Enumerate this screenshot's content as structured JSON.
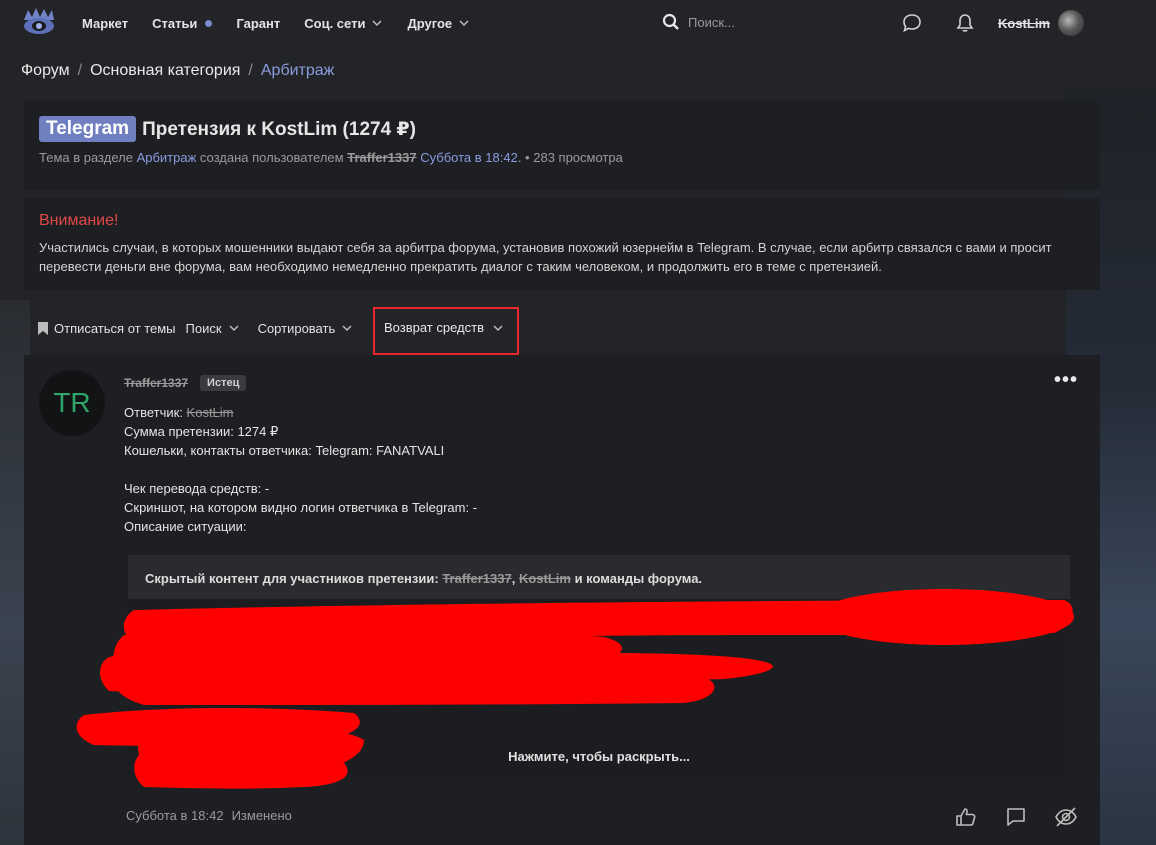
{
  "nav": {
    "items": [
      {
        "label": "Маркет",
        "has_dot": false,
        "has_chevron": false
      },
      {
        "label": "Статьи",
        "has_dot": true,
        "has_chevron": false
      },
      {
        "label": "Гарант",
        "has_dot": false,
        "has_chevron": false
      },
      {
        "label": "Соц. сети",
        "has_dot": false,
        "has_chevron": true
      },
      {
        "label": "Другое",
        "has_dot": false,
        "has_chevron": true
      }
    ],
    "search_placeholder": "Поиск...",
    "username": "KostLim",
    "icons": [
      "logo-icon",
      "search-icon",
      "chat-icon",
      "bell-icon"
    ]
  },
  "breadcrumb": {
    "items": [
      "Форум",
      "Основная категория",
      "Арбитраж"
    ]
  },
  "thread": {
    "tag": "Telegram",
    "title": "Претензия к KostLim (1274 ₽)",
    "meta_prefix": "Тема в разделе",
    "meta_section": "Арбитраж",
    "meta_created": "создана пользователем",
    "meta_author": "Traffer1337",
    "meta_date": "Суббота в 18:42",
    "meta_views": "283 просмотра"
  },
  "notice": {
    "title": "Внимание!",
    "text": "Участились случаи, в которых мошенники выдают себя за арбитра форума, установив похожий юзернейм в Telegram. В случае, если арбитр связался с вами и просит перевести деньги вне форума, вам необходимо немедленно прекратить диалог с таким человеком, и продолжить его в теме с претензией."
  },
  "toolbar": {
    "unsubscribe": "Отписаться от темы",
    "search": "Поиск",
    "sort": "Сортировать",
    "refund": "Возврат средств"
  },
  "post": {
    "avatar_initials": "TR",
    "author": "Traffer1337",
    "role_badge": "Истец",
    "respondent_label": "Ответчик:",
    "respondent": "KostLim",
    "amount_line": "Сумма претензии: 1274 ₽",
    "contacts_line": "Кошельки, контакты ответчика: Telegram: FANATVALI",
    "receipt_line": "Чек перевода средств: -",
    "screenshot_line": "Скриншот, на котором видно логин ответчика в Telegram: -",
    "description_line": "Описание ситуации:",
    "hidden_prefix": "Скрытый контент для участников претензии:",
    "hidden_user1": "Traffer1337",
    "hidden_comma": ",",
    "hidden_user2": "KostLim",
    "hidden_suffix": "и команды форума.",
    "expand_label": "Нажмите, чтобы раскрыть...",
    "footer_date": "Суббота в 18:42",
    "footer_edited": "Изменено"
  },
  "colors": {
    "accent": "#8a9ce0",
    "tag_bg": "#6f7fbf",
    "warning": "#e04848",
    "highlight_border": "#e8262b",
    "redaction": "#ff0000",
    "avatar_text": "#2fa56a"
  }
}
